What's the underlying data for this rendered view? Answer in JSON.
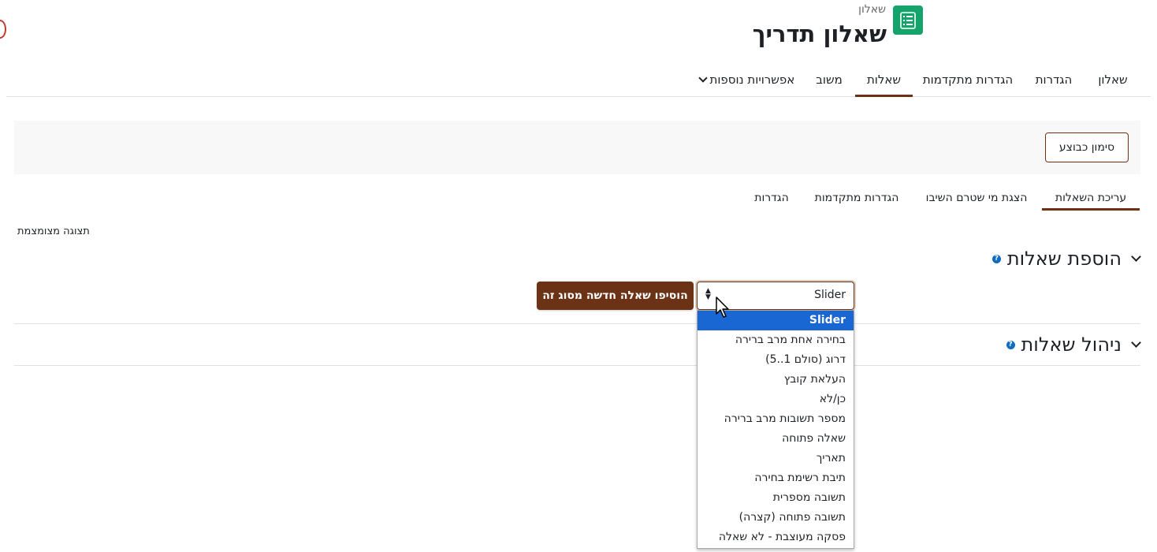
{
  "header": {
    "subtitle": "שאלון",
    "title": "שאלון תדריך",
    "icon": "survey-list-icon",
    "icon_color": "#14a36b"
  },
  "primary_tabs": [
    {
      "label": "שאלון",
      "active": false
    },
    {
      "label": "הגדרות",
      "active": false
    },
    {
      "label": "הגדרות מתקדמות",
      "active": false
    },
    {
      "label": "שאלות",
      "active": true
    },
    {
      "label": "משוב",
      "active": false
    },
    {
      "label": "אפשרויות נוספות",
      "active": false
    }
  ],
  "action_bar": {
    "mark_done_label": "סימון כבוצע"
  },
  "secondary_tabs": [
    {
      "label": "עריכת השאלות",
      "active": true
    },
    {
      "label": "הצגת מי שטרם השיבו",
      "active": false
    },
    {
      "label": "הגדרות מתקדמות",
      "active": false
    },
    {
      "label": "הגדרות",
      "active": false
    }
  ],
  "compact_view_label": "תצוגה מצומצמת",
  "add_questions": {
    "heading": "הוספת שאלות",
    "selected_type": "Slider",
    "add_button_label": "הוסיפו שאלה חדשה מסוג זה",
    "options": [
      "Slider",
      "בחירה אחת מרב ברירה",
      "דרוג (סולם 1..5)",
      "העלאת קובץ",
      "כן/לא",
      "מספר תשובות מרב ברירה",
      "שאלה פתוחה",
      "תאריך",
      "תיבת רשימת בחירה",
      "תשובה מספרית",
      "תשובה פתוחה (קצרה)",
      "פסקה מעוצבת - לא שאלה"
    ]
  },
  "manage_questions": {
    "heading": "ניהול שאלות"
  },
  "colors": {
    "brand": "#6b3216",
    "selected_option": "#1967d2",
    "help_icon": "#0f6cbf"
  }
}
